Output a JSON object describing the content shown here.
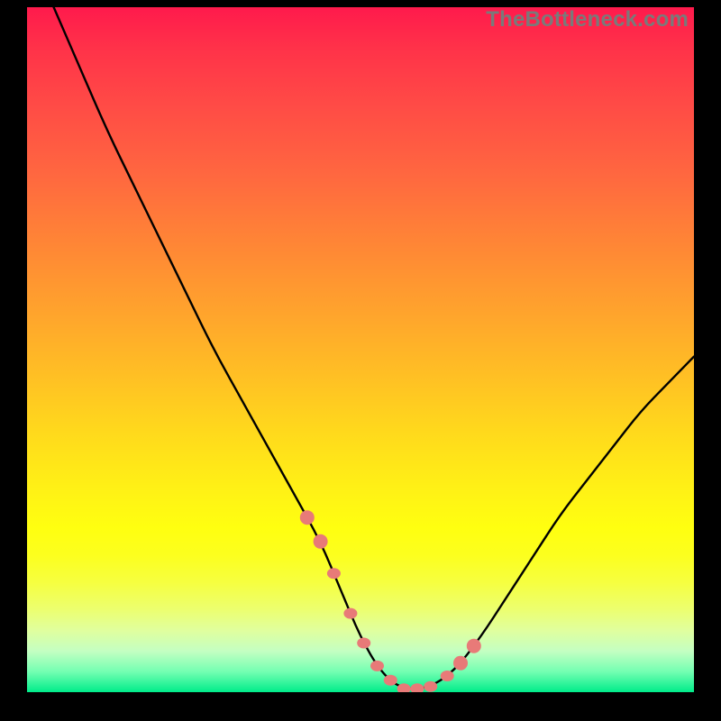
{
  "watermark_text": "TheBottleneck.com",
  "colors": {
    "background": "#000000",
    "curve": "#000000",
    "bead": "#e87a78",
    "gradient_top": "#ff1a4c",
    "gradient_bottom": "#00ec8a"
  },
  "chart_data": {
    "type": "line",
    "title": "",
    "xlabel": "",
    "ylabel": "",
    "xlim": [
      0,
      100
    ],
    "ylim": [
      0,
      100
    ],
    "grid": false,
    "legend": false,
    "annotations": [
      "TheBottleneck.com"
    ],
    "series": [
      {
        "name": "bottleneck-curve",
        "x": [
          4,
          8,
          12,
          16,
          20,
          24,
          28,
          32,
          36,
          40,
          44,
          47,
          50,
          53,
          56,
          60,
          64,
          68,
          72,
          76,
          80,
          84,
          88,
          92,
          96,
          100
        ],
        "y": [
          100,
          91,
          82,
          74,
          66,
          58,
          50,
          43,
          36,
          29,
          22,
          15,
          8,
          3,
          0.5,
          0.5,
          3,
          8,
          14,
          20,
          26,
          31,
          36,
          41,
          45,
          49
        ],
        "note": "Values estimated from pixel positions; y = 0 is chart bottom."
      }
    ],
    "beads": {
      "note": "Highlighted near-zero bottleneck region markers (approximate x positions along curve).",
      "x": [
        42,
        44,
        46,
        48.5,
        50.5,
        52.5,
        54.5,
        56.5,
        58.5,
        60.5,
        63,
        65,
        67
      ]
    }
  }
}
